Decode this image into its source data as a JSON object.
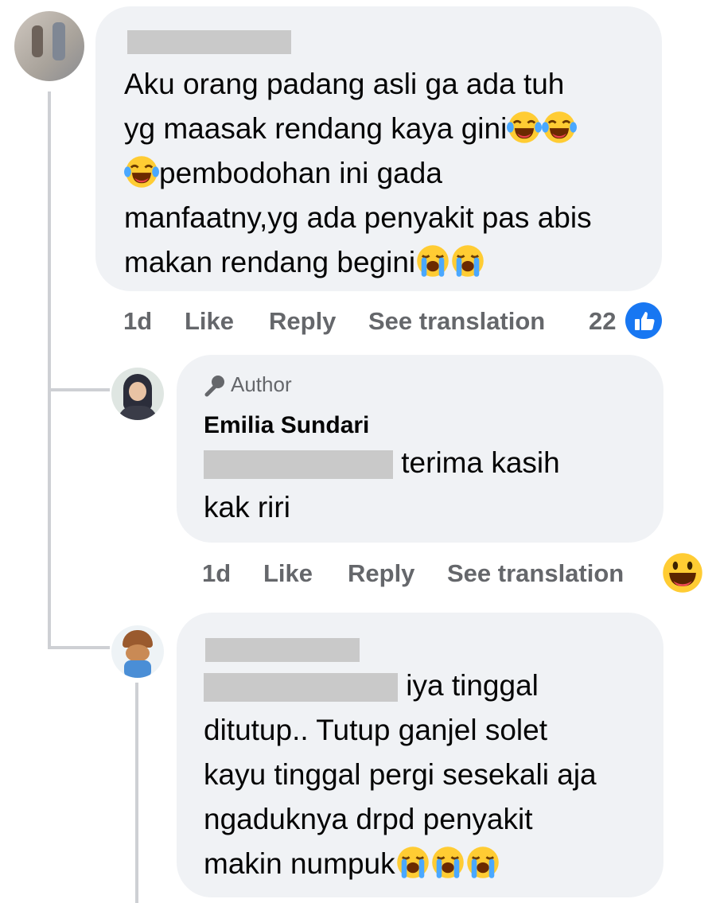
{
  "comment1": {
    "lines": [
      "Aku orang padang asli ga ada tuh",
      "yg maasak rendang kaya gini",
      "pembodohan ini gada",
      "manfaatny,yg ada penyakit pas abis",
      "makan rendang begini"
    ],
    "time": "1d",
    "like": "Like",
    "reply": "Reply",
    "translate": "See translation",
    "reaction_count": "22"
  },
  "reply1": {
    "badge": "Author",
    "name": "Emilia Sundari",
    "line1": " terima kasih",
    "line2": "kak riri",
    "time": "1d",
    "like": "Like",
    "reply": "Reply",
    "translate": "See translation"
  },
  "reply2": {
    "line1": " iya tinggal",
    "line2": "ditutup.. Tutup ganjel solet",
    "line3": "kayu tinggal pergi sesekali aja",
    "line4": "ngaduknya drpd penyakit",
    "line5": "makin numpuk"
  },
  "colors": {
    "bubble": "#f0f2f5",
    "meta_text": "#65676b",
    "like_blue": "#1877f2",
    "thread_line": "#ced0d4"
  }
}
